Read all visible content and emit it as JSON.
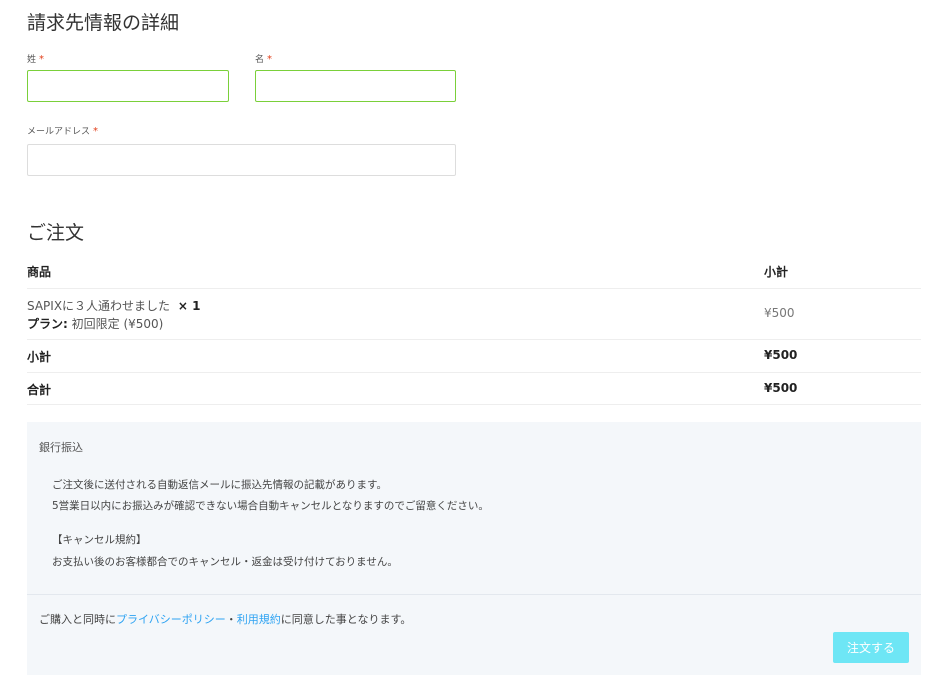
{
  "billing": {
    "title": "請求先情報の詳細",
    "last_name_label": "姓",
    "first_name_label": "名",
    "email_label": "メールアドレス",
    "required_mark": "*",
    "last_name_value": "",
    "first_name_value": "",
    "email_value": ""
  },
  "order": {
    "title": "ご注文",
    "col_product": "商品",
    "col_subtotal": "小計",
    "item_name": "SAPIXに３人通わせました",
    "item_qty": "× 1",
    "plan_label": "プラン:",
    "plan_value": "初回限定 (¥500)",
    "item_price": "¥500",
    "subtotal_label": "小計",
    "subtotal_value": "¥500",
    "total_label": "合計",
    "total_value": "¥500"
  },
  "payment": {
    "method": "銀行振込",
    "desc1": "ご注文後に送付される自動返信メールに振込先情報の記載があります。",
    "desc2": "5営業日以内にお振込みが確認できない場合自動キャンセルとなりますのでご留意ください。",
    "desc3": "【キャンセル規約】",
    "desc4": "お支払い後のお客様都合でのキャンセル・返金は受け付けておりません。",
    "terms_prefix": "ご購入と同時に",
    "privacy_link": "プライバシーポリシー",
    "terms_sep": "・",
    "terms_link": "利用規約",
    "terms_suffix": "に同意した事となります。",
    "submit_label": "注文する"
  },
  "colors": {
    "valid_border": "#7ad03a",
    "required": "#e2401c",
    "link": "#2ea3f2",
    "button": "#6ee6f5",
    "payment_bg": "#f4f7fa"
  }
}
